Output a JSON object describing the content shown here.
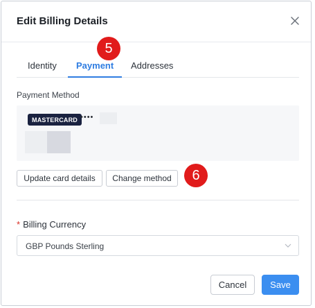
{
  "modal": {
    "title": "Edit Billing Details",
    "close_icon": "close-icon"
  },
  "tabs": [
    {
      "label": "Identity",
      "active": false
    },
    {
      "label": "Payment",
      "active": true
    },
    {
      "label": "Addresses",
      "active": false
    }
  ],
  "annotations": {
    "step_tabs": "5",
    "step_buttons": "6"
  },
  "payment": {
    "section_label": "Payment Method",
    "card_brand": "MASTERCARD",
    "card_mask": "••••",
    "update_button": "Update card details",
    "change_button": "Change method"
  },
  "currency": {
    "label": "Billing Currency",
    "required_mark": "*",
    "selected": "GBP Pounds Sterling"
  },
  "footer": {
    "cancel": "Cancel",
    "save": "Save"
  },
  "colors": {
    "accent": "#2f7de1",
    "primary_button": "#3b8ef0",
    "badge": "#e11b1b",
    "card_brand_bg": "#1a2240"
  }
}
